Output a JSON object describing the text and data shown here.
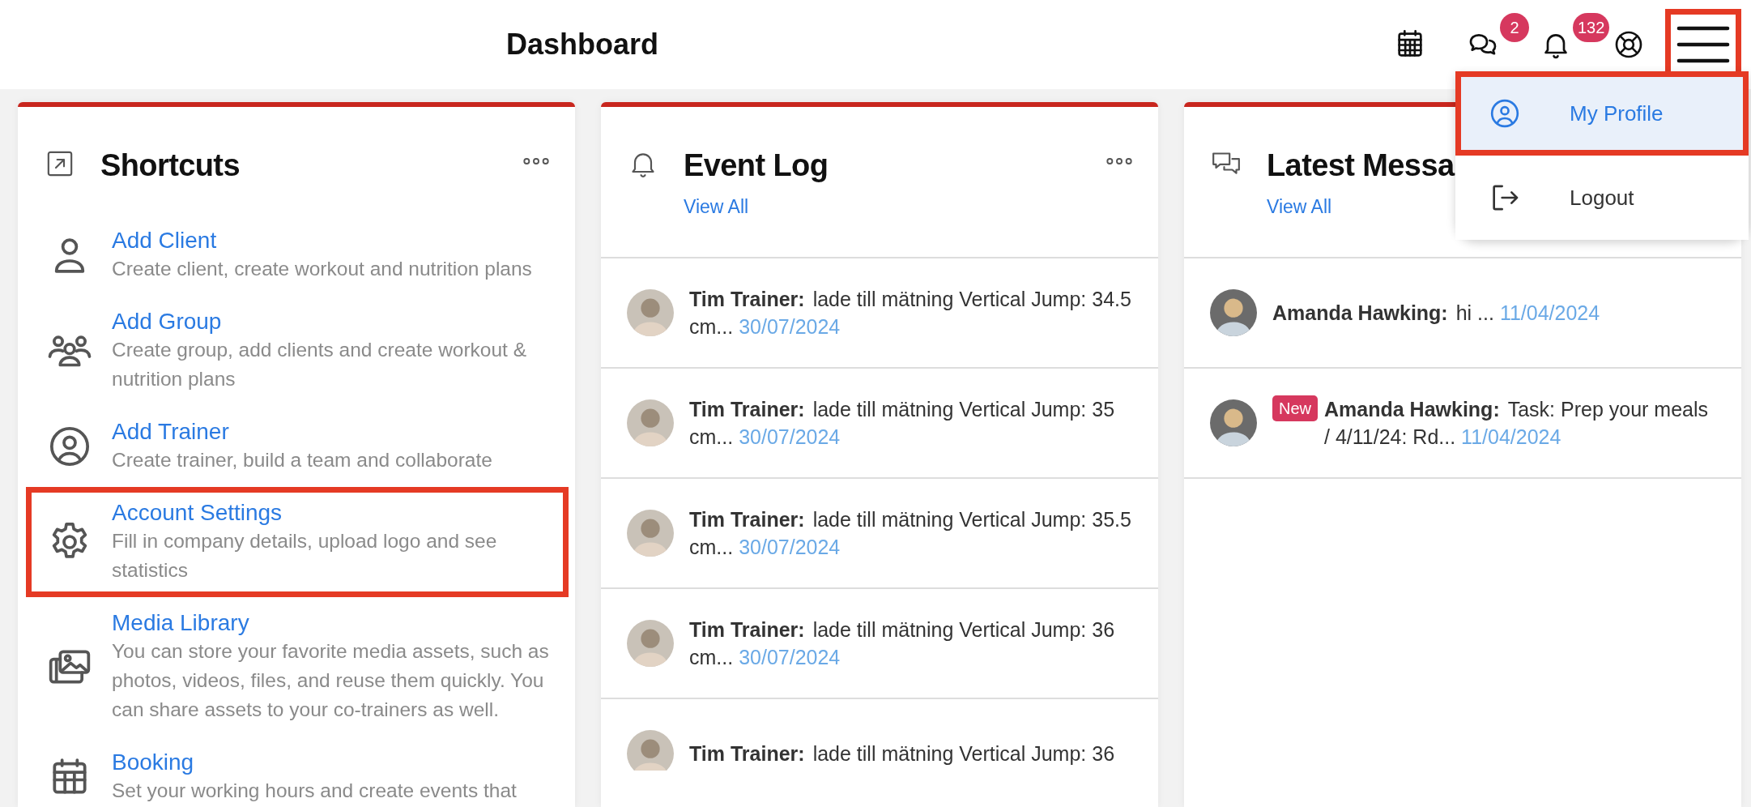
{
  "header": {
    "title": "Dashboard",
    "icons": [
      {
        "kind": "calendar"
      },
      {
        "kind": "chat",
        "badge": "2"
      },
      {
        "kind": "bell",
        "badge": "132"
      },
      {
        "kind": "help"
      }
    ],
    "menu_button": {
      "highlighted": true
    }
  },
  "menu": {
    "items": [
      {
        "kind": "profile",
        "label": "My Profile",
        "selected": true,
        "highlighted": true
      },
      {
        "kind": "logout",
        "label": "Logout",
        "selected": false,
        "highlighted": false
      }
    ]
  },
  "shortcuts": {
    "title": "Shortcuts",
    "items": [
      {
        "kind": "client",
        "title": "Add Client",
        "description": "Create client, create workout and nutrition plans",
        "highlighted": false
      },
      {
        "kind": "group",
        "title": "Add Group",
        "description": "Create group, add clients and create workout & nutrition plans",
        "highlighted": false
      },
      {
        "kind": "trainer",
        "title": "Add Trainer",
        "description": "Create trainer, build a team and collaborate",
        "highlighted": false
      },
      {
        "kind": "settings",
        "title": "Account Settings",
        "description": "Fill in company details, upload logo and see statistics",
        "highlighted": true
      },
      {
        "kind": "media",
        "title": "Media Library",
        "description": "You can store your favorite media assets, such as photos, videos, files, and reuse them quickly. You can share assets to your co-trainers as well.",
        "highlighted": false
      },
      {
        "kind": "booking",
        "title": "Booking",
        "description": "Set your working hours and create events that",
        "highlighted": false
      }
    ]
  },
  "event_log": {
    "title": "Event Log",
    "view_all": "View All",
    "entries": [
      {
        "author": "Tim Trainer:",
        "text": "lade till mätning Vertical Jump: 34.5 cm...",
        "date": "30/07/2024"
      },
      {
        "author": "Tim Trainer:",
        "text": "lade till mätning Vertical Jump: 35 cm...",
        "date": "30/07/2024"
      },
      {
        "author": "Tim Trainer:",
        "text": "lade till mätning Vertical Jump: 35.5 cm...",
        "date": "30/07/2024"
      },
      {
        "author": "Tim Trainer:",
        "text": "lade till mätning Vertical Jump: 36 cm...",
        "date": "30/07/2024"
      },
      {
        "author": "Tim Trainer:",
        "text": "lade till mätning Vertical Jump: 36"
      }
    ]
  },
  "messages": {
    "title": "Latest Messa",
    "view_all": "View All",
    "entries": [
      {
        "author": "Amanda Hawking:",
        "text": "hi ...",
        "date": "11/04/2024"
      },
      {
        "badge": "New",
        "author": "Amanda Hawking:",
        "text": "Task: Prep your meals / 4/11/24: Rd...",
        "date": "11/04/2024"
      }
    ]
  }
}
